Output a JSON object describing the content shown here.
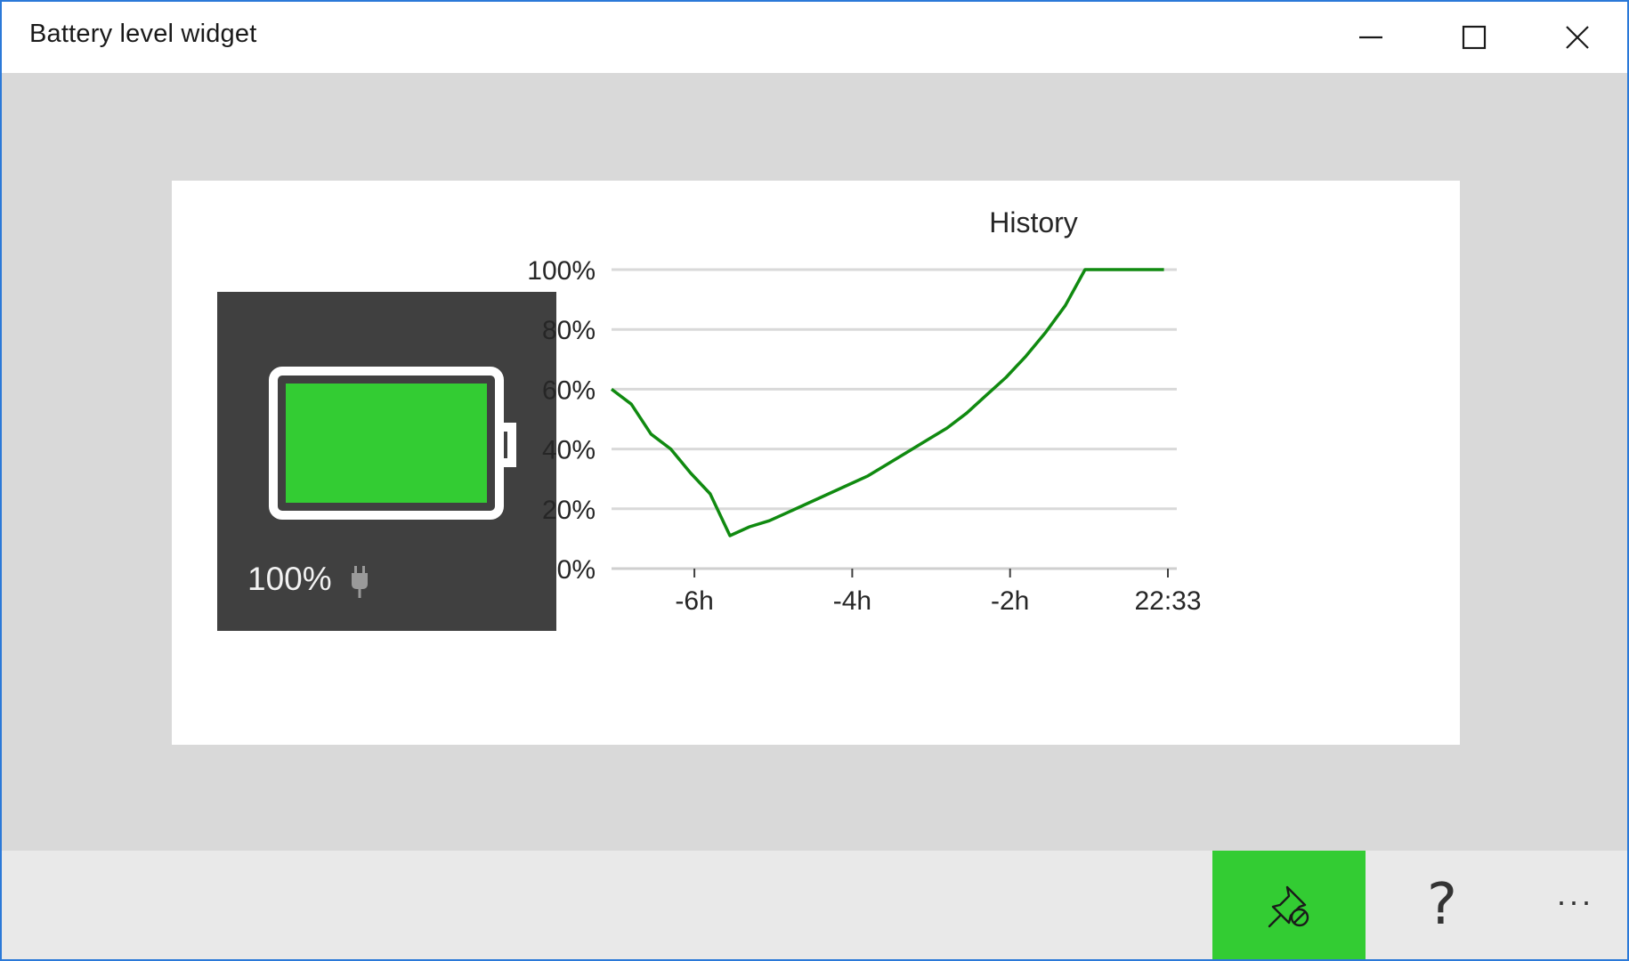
{
  "window": {
    "title": "Battery level widget",
    "controls": [
      "minimize",
      "maximize",
      "close"
    ]
  },
  "battery": {
    "percent_label": "100%",
    "level": 1.0,
    "charging": true,
    "fill_color": "#33cc33",
    "icons": [
      "battery-icon",
      "plug-icon"
    ]
  },
  "chart_data": {
    "type": "line",
    "title": "History",
    "xlabel": "",
    "ylabel": "",
    "y_tick_labels": [
      "0%",
      "20%",
      "40%",
      "60%",
      "80%",
      "100%"
    ],
    "y_ticks": [
      0,
      20,
      40,
      60,
      80,
      100
    ],
    "ylim": [
      0,
      100
    ],
    "x_tick_labels": [
      "-6h",
      "-4h",
      "-2h",
      "22:33"
    ],
    "x_ticks": [
      -6,
      -4,
      -2,
      0
    ],
    "xlim": [
      -7.05,
      0
    ],
    "grid": true,
    "line_color": "#108a10",
    "series": [
      {
        "x": [
          -7.05,
          -6.8,
          -6.55,
          -6.3,
          -6.05,
          -5.8,
          -5.55,
          -5.3,
          -5.05,
          -4.8,
          -4.55,
          -4.3,
          -4.05,
          -3.8,
          -3.55,
          -3.3,
          -3.05,
          -2.8,
          -2.55,
          -2.3,
          -2.05,
          -1.8,
          -1.55,
          -1.3,
          -1.05,
          -0.8,
          -0.55,
          -0.3,
          -0.05
        ],
        "y": [
          60,
          55,
          45,
          40,
          32,
          25,
          11,
          14,
          16,
          19,
          22,
          25,
          28,
          31,
          35,
          39,
          43,
          47,
          52,
          58,
          64,
          71,
          79,
          88,
          100,
          100,
          100,
          100,
          100
        ]
      }
    ]
  },
  "appbar": {
    "unpin_active_color": "#33cc33",
    "help_label": "?",
    "more_label": "···",
    "icons": [
      "unpin-icon"
    ]
  }
}
